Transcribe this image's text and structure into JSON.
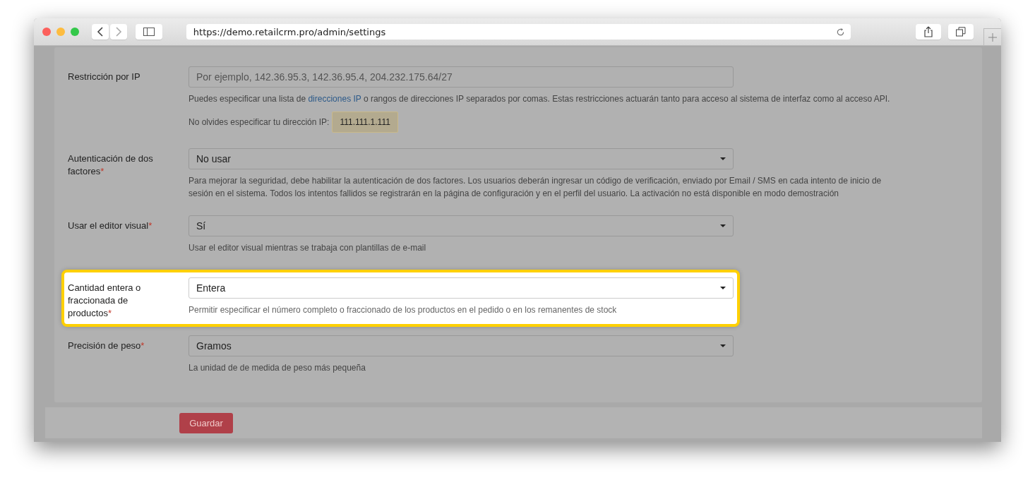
{
  "browser": {
    "url": "https://demo.retailcrm.pro/admin/settings"
  },
  "fields": [
    {
      "label": "Restricción por IP",
      "highlighted": false,
      "kind": "input",
      "placeholder": "Por ejemplo, 142.36.95.3, 142.36.95.4, 204.232.175.64/27",
      "help": "Puedes especificar una lista de ",
      "help_link": "direcciones IP",
      "help_after": " o rangos de direcciones IP separados por comas. Estas restricciones actuarán tanto para acceso al sistema de interfaz como al acceso API.",
      "ip_note": "No olvides especificar tu dirección IP:",
      "ip_value": "111.111.1.111"
    },
    {
      "label": "Autenticación de dos factores",
      "required_mark": "*",
      "highlighted": false,
      "kind": "select",
      "value": "No usar",
      "help": "Para mejorar la seguridad, debe habilitar la autenticación de dos factores. Los usuarios deberán ingresar un código de verificación, enviado por Email / SMS en cada intento de inicio de sesión en el sistema. Todos los intentos fallidos se registrarán en la página de configuración y en el perfil del usuario. La activación no está disponible en modo demostración"
    },
    {
      "label": "Usar el editor visual",
      "required_mark": "*",
      "highlighted": false,
      "kind": "select",
      "value": "Sí",
      "help": "Usar el editor visual mientras se trabaja con plantillas de e-mail"
    },
    {
      "label": "Cantidad entera o fraccionada de productos",
      "required_mark": "*",
      "highlighted": true,
      "kind": "select",
      "value": "Entera",
      "help": "Permitir especificar el número completo o fraccionado de los productos en el pedido o en los remanentes de stock"
    },
    {
      "label": "Precisión de peso",
      "required_mark": "*",
      "highlighted": false,
      "kind": "select",
      "value": "Gramos",
      "help": "La unidad de de medida de peso más pequeña"
    }
  ],
  "save_button": "Guardar"
}
